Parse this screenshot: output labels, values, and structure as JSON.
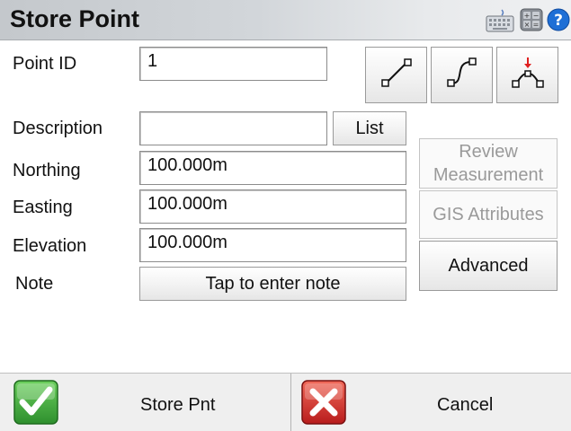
{
  "header": {
    "title": "Store Point",
    "icons": [
      "keyboard-icon",
      "calculator-icon",
      "help-icon"
    ]
  },
  "form": {
    "point_id": {
      "label": "Point ID",
      "value": "1"
    },
    "description": {
      "label": "Description",
      "value": ""
    },
    "northing": {
      "label": "Northing",
      "value": "100.000m"
    },
    "easting": {
      "label": "Easting",
      "value": "100.000m"
    },
    "elevation": {
      "label": "Elevation",
      "value": "100.000m"
    },
    "note": {
      "label": "Note",
      "button_label": "Tap to enter note"
    }
  },
  "buttons": {
    "list": "List",
    "review_line1": "Review",
    "review_line2": "Measurement",
    "gis_attributes": "GIS Attributes",
    "advanced": "Advanced"
  },
  "tool_icons": [
    "line-icon",
    "curve-icon",
    "arc-point-icon"
  ],
  "footer": {
    "store": "Store Pnt",
    "cancel": "Cancel"
  },
  "colors": {
    "check_green": "#3aa63a",
    "cancel_red": "#d42a2a",
    "help_blue": "#1f6fd6",
    "disabled_text": "#9a9a9a"
  }
}
